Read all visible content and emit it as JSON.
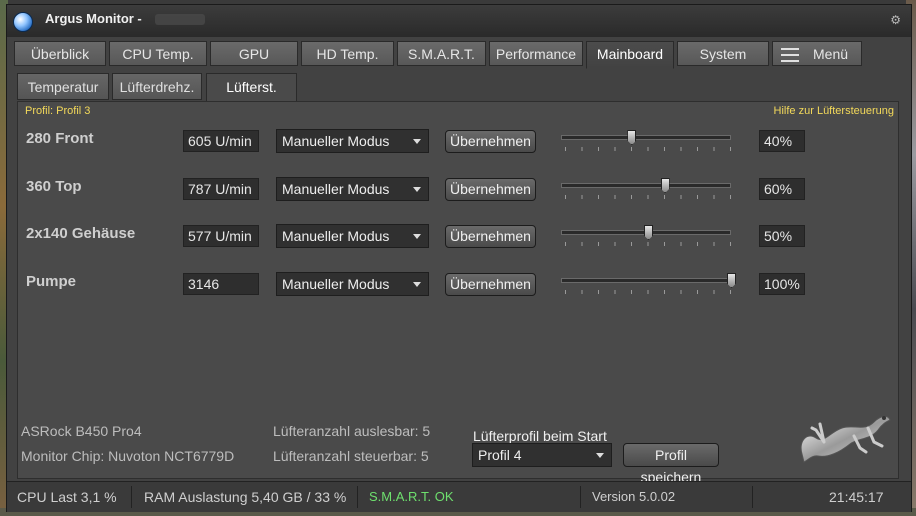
{
  "window": {
    "title": "Argus Monitor -"
  },
  "main_tabs": [
    {
      "label": "Überblick"
    },
    {
      "label": "CPU Temp."
    },
    {
      "label": "GPU"
    },
    {
      "label": "HD Temp."
    },
    {
      "label": "S.M.A.R.T."
    },
    {
      "label": "Performance"
    },
    {
      "label": "Mainboard"
    },
    {
      "label": "System"
    },
    {
      "label": "Menü"
    }
  ],
  "active_main_tab": "Mainboard",
  "sub_tabs": [
    {
      "label": "Temperatur"
    },
    {
      "label": "Lüfterdrehz."
    },
    {
      "label": "Lüfterst."
    }
  ],
  "active_sub_tab": "Lüfterst.",
  "panel": {
    "profile_label": "Profil: Profil 3",
    "help_link": "Hilfe zur Lüftersteuerung"
  },
  "fans": [
    {
      "name": "280 Front",
      "rpm": "605 U/min",
      "mode": "Manueller Modus",
      "apply": "Übernehmen",
      "percent_label": "40%",
      "percent": 40
    },
    {
      "name": "360 Top",
      "rpm": "787 U/min",
      "mode": "Manueller Modus",
      "apply": "Übernehmen",
      "percent_label": "60%",
      "percent": 60
    },
    {
      "name": "2x140 Gehäuse",
      "rpm": "577 U/min",
      "mode": "Manueller Modus",
      "apply": "Übernehmen",
      "percent_label": "50%",
      "percent": 50
    },
    {
      "name": "Pumpe",
      "rpm": "3146",
      "mode": "Manueller Modus",
      "apply": "Übernehmen",
      "percent_label": "100%",
      "percent": 100
    }
  ],
  "board": {
    "name": "ASRock B450 Pro4",
    "chip": "Monitor Chip: Nuvoton NCT6779D",
    "fans_readable": "Lüfteranzahl auslesbar: 5",
    "fans_controllable": "Lüfteranzahl steuerbar: 5"
  },
  "startup": {
    "label": "Lüfterprofil beim Start",
    "selected_profile": "Profil 4",
    "save_button": "Profil speichern"
  },
  "statusbar": {
    "cpu": "CPU Last 3,1 %",
    "ram": "RAM Auslastung 5,40 GB / 33 %",
    "smart": "S.M.A.R.T. OK",
    "version": "Version 5.0.02",
    "time": "21:45:17"
  },
  "colors": {
    "accent_yellow": "#f3d95a",
    "smart_ok": "#6ee06e",
    "background": "#424242"
  },
  "icons": {
    "app": "argus-monitor-logo",
    "menu": "hamburger-icon",
    "gecko": "gecko-logo"
  }
}
